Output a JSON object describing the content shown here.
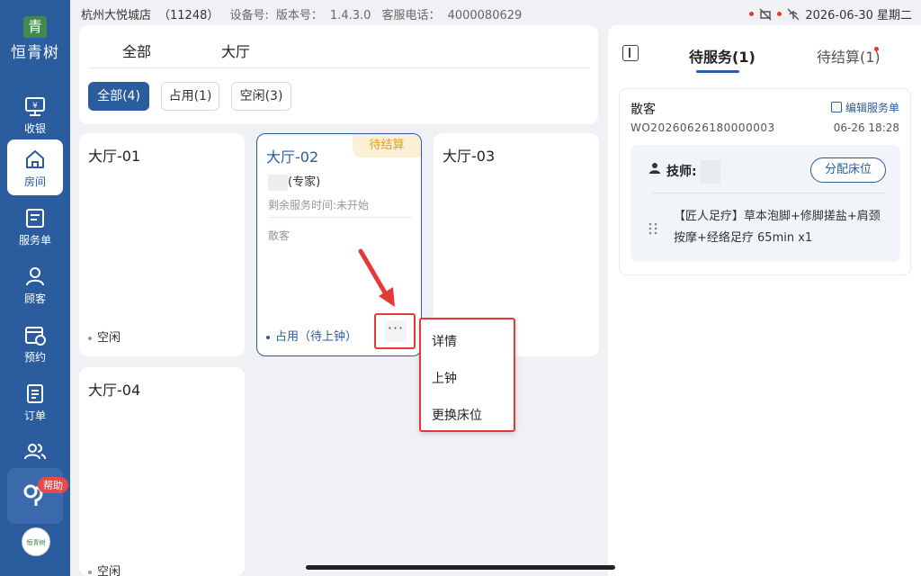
{
  "status_bar": {
    "store": "杭州大悦城店",
    "store_code": "（11248）",
    "device_label": "设备号:",
    "version_label": "版本号：",
    "version": "1.4.3.0",
    "hotline_label": "客服电话：",
    "hotline": "4000080629",
    "datetime": "2026-06-30 星期二"
  },
  "sidebar": {
    "logo_mark": "青",
    "logo_text": "恒青树",
    "items": [
      {
        "label": "收银",
        "icon": "cashier-icon"
      },
      {
        "label": "房间",
        "icon": "home-icon",
        "active": true
      },
      {
        "label": "服务单",
        "icon": "service-order-icon"
      },
      {
        "label": "顾客",
        "icon": "customer-icon"
      },
      {
        "label": "预约",
        "icon": "calendar-icon"
      },
      {
        "label": "订单",
        "icon": "order-icon"
      },
      {
        "label": "",
        "icon": "staff-icon"
      }
    ],
    "help_badge": "帮助",
    "avatar_text": "恒青树"
  },
  "filters": {
    "tabs": [
      "全部",
      "大厅"
    ],
    "chips": [
      {
        "label": "全部(4)",
        "active": true
      },
      {
        "label": "占用(1)",
        "active": false
      },
      {
        "label": "空闲(3)",
        "active": false
      }
    ]
  },
  "rooms": [
    {
      "name": "大厅-01",
      "status": "空闲"
    },
    {
      "name": "大厅-02",
      "tag": "待结算",
      "tech_suffix": "(专家)",
      "remaining": "剩余服务时间:未开始",
      "guest": "散客",
      "status": "占用（待上钟）",
      "more": "···"
    },
    {
      "name": "大厅-03"
    },
    {
      "name": "大厅-04",
      "status": "空闲"
    }
  ],
  "popup_menu": [
    "详情",
    "上钟",
    "更换床位"
  ],
  "right_panel": {
    "tabs": [
      "待服务(1)",
      "待结算(1)"
    ],
    "order": {
      "customer": "散客",
      "edit_label": "编辑服务单",
      "order_no": "WO20260626180000003",
      "time": "06-26 18:28",
      "tech_label": "技师:",
      "assign_label": "分配床位",
      "service": "【匠人足疗】草本泡脚+修脚搓盐+肩颈按摩+经络足疗 65min x1"
    }
  },
  "colors": {
    "primary": "#2a5c9e",
    "alert": "#e53935",
    "pending_tag_bg": "#fbf0d6",
    "pending_tag_text": "#e0a020"
  }
}
